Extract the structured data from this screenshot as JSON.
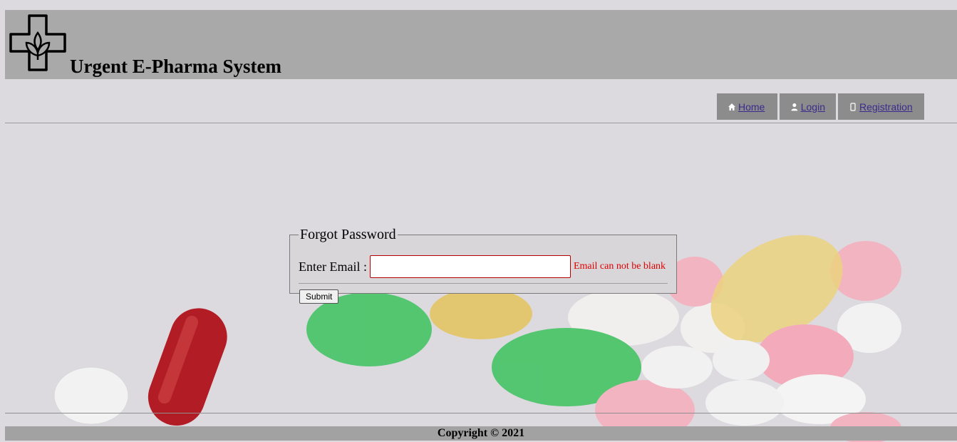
{
  "header": {
    "title": "Urgent E-Pharma System",
    "logo_icon": "pharmacy-cross-leaf-icon"
  },
  "nav": {
    "items": [
      {
        "label": " Home",
        "icon": "home-icon"
      },
      {
        "label": " Login",
        "icon": "user-icon"
      },
      {
        "label": " Registration",
        "icon": "mobile-icon"
      }
    ],
    "link_color": "#3c2a8c"
  },
  "form": {
    "legend": "Forgot Password",
    "email_label": "Enter Email :",
    "email_value": "",
    "error_text": "Email can not be blank",
    "error_color": "#e00000",
    "submit_label": "Submit"
  },
  "footer": {
    "copyright": "Copyright © 2021"
  },
  "colors": {
    "header_bg": "#a9a9a9",
    "nav_bg": "#8c8c8c",
    "page_bg": "#dcdadf"
  }
}
